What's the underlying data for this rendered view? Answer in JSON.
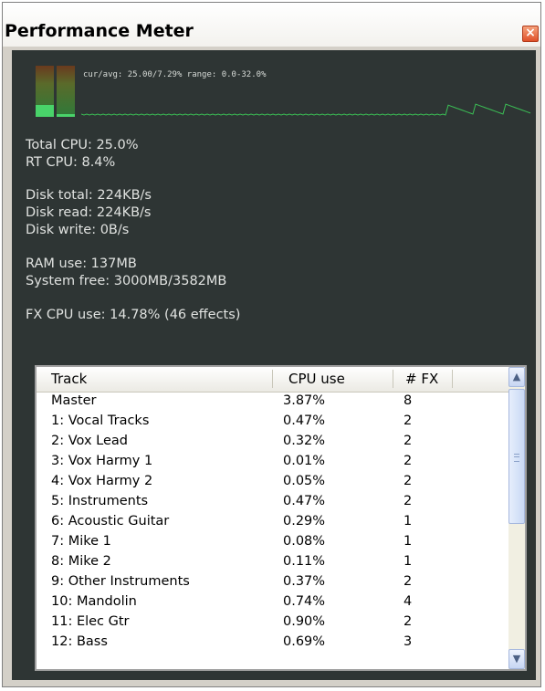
{
  "window": {
    "title": "Performance Meter",
    "close_glyph": "×"
  },
  "graph": {
    "caption": "cur/avg: 25.00/7.29%  range: 0.0-32.0%"
  },
  "stats": {
    "total_cpu": "Total CPU: 25.0%",
    "rt_cpu": "RT CPU: 8.4%",
    "disk_total": "Disk total: 224KB/s",
    "disk_read": "Disk read: 224KB/s",
    "disk_write": "Disk write: 0B/s",
    "ram_use": "RAM use: 137MB",
    "system_free": "System free: 3000MB/3582MB",
    "fx_cpu": "FX CPU use: 14.78% (46 effects)"
  },
  "table": {
    "columns": [
      "Track",
      "CPU use",
      "# FX"
    ],
    "rows": [
      [
        "Master",
        "3.87%",
        "8"
      ],
      [
        "1: Vocal Tracks",
        "0.47%",
        "2"
      ],
      [
        "2: Vox Lead",
        "0.32%",
        "2"
      ],
      [
        "3: Vox Harmy 1",
        "0.01%",
        "2"
      ],
      [
        "4: Vox Harmy 2",
        "0.05%",
        "2"
      ],
      [
        "5: Instruments",
        "0.47%",
        "2"
      ],
      [
        "6: Acoustic Guitar",
        "0.29%",
        "1"
      ],
      [
        "7: Mike 1",
        "0.08%",
        "1"
      ],
      [
        "8: Mike 2",
        "0.11%",
        "1"
      ],
      [
        "9: Other Instruments",
        "0.37%",
        "2"
      ],
      [
        "10: Mandolin",
        "0.74%",
        "4"
      ],
      [
        "11: Elec Gtr",
        "0.90%",
        "2"
      ],
      [
        "12: Bass",
        "0.69%",
        "3"
      ]
    ]
  },
  "scrollbar": {
    "up_glyph": "▲",
    "down_glyph": "▼"
  },
  "colors": {
    "panel_bg": "#2e3534",
    "meter_green": "#49d36a",
    "graph_line": "#3bbf55"
  }
}
